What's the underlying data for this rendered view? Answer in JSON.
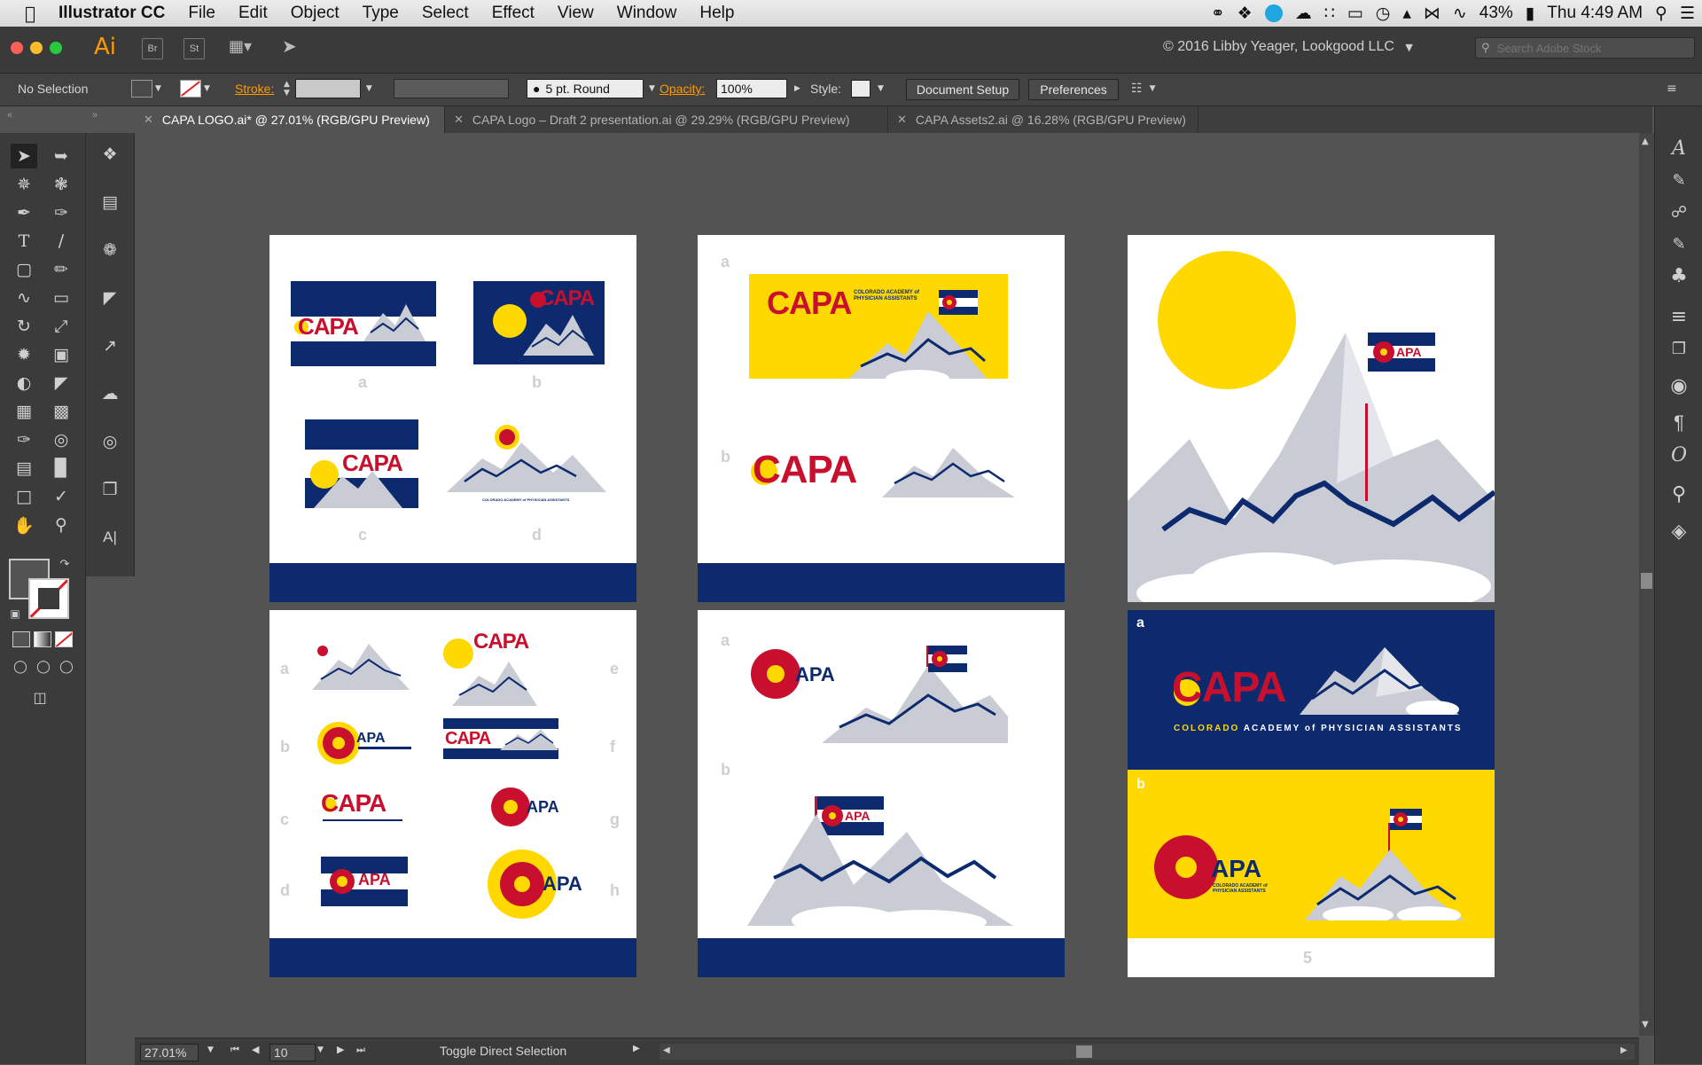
{
  "menubar": {
    "app_name": "Illustrator CC",
    "items": [
      "File",
      "Edit",
      "Object",
      "Type",
      "Select",
      "Effect",
      "View",
      "Window",
      "Help"
    ],
    "battery": "43%",
    "clock": "Thu 4:49 AM"
  },
  "appbar": {
    "app_logo": "Ai",
    "bridge": "Br",
    "stock": "St",
    "workspace_owner": "© 2016 Libby Yeager, Lookgood LLC",
    "search_placeholder": "Search Adobe Stock"
  },
  "control": {
    "selection": "No Selection",
    "stroke_label": "Stroke:",
    "brush": "5 pt. Round",
    "opacity_label": "Opacity:",
    "opacity_value": "100%",
    "style_label": "Style:",
    "document_setup": "Document Setup",
    "preferences": "Preferences"
  },
  "tabs": [
    {
      "label": "CAPA LOGO.ai* @ 27.01% (RGB/GPU Preview)",
      "active": true
    },
    {
      "label": "CAPA Logo – Draft 2 presentation.ai @ 29.29% (RGB/GPU Preview)",
      "active": false
    },
    {
      "label": "CAPA Assets2.ai @ 16.28% (RGB/GPU Preview)",
      "active": false
    }
  ],
  "artboards": {
    "capa": "CAPA",
    "apa": "APA",
    "full_name": "COLORADO ACADEMY of PHYSICIAN ASSISTANTS",
    "colorado": "COLORADO",
    "rest_name": "ACADEMY of PHYSICIAN ASSISTANTS",
    "small_name": "COLORADO ACADEMY of PHYSICIAN ASSISTANTS",
    "letters": [
      "a",
      "b",
      "c",
      "d",
      "e",
      "f",
      "g",
      "h"
    ],
    "page_number": "5"
  },
  "colors": {
    "navy": "#0d2a6e",
    "red": "#c8102e",
    "yellow": "#ffd800",
    "mountain": "#c9ccd4",
    "ui_dark": "#3b3b3b"
  },
  "status": {
    "zoom": "27.01%",
    "artboard": "10",
    "tool_hint": "Toggle Direct Selection"
  }
}
